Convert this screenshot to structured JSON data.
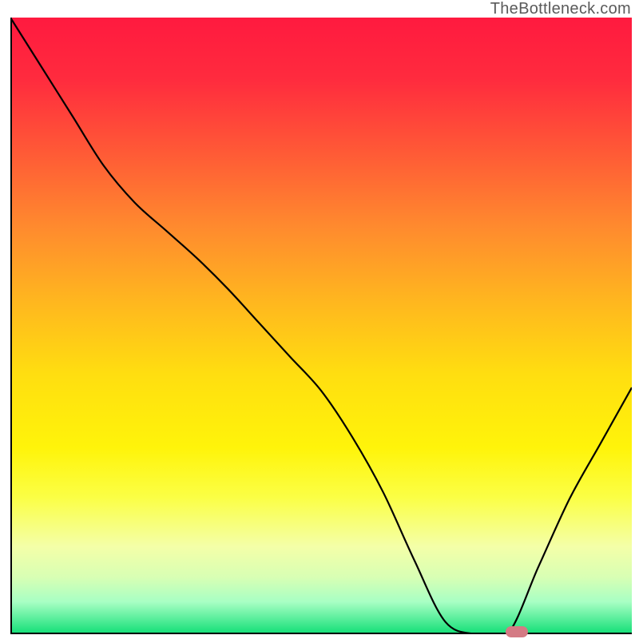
{
  "attribution": "TheBottleneck.com",
  "chart_data": {
    "type": "line",
    "title": "",
    "xlabel": "",
    "ylabel": "",
    "x": [
      0,
      1,
      2,
      3,
      4,
      5,
      6,
      7,
      8,
      9,
      10,
      11,
      12,
      13,
      14,
      15,
      16,
      17,
      18,
      19,
      20
    ],
    "values": [
      100,
      92,
      84,
      76,
      70,
      65.5,
      61,
      56,
      50.5,
      45,
      39.5,
      32,
      23,
      12,
      2,
      0,
      0,
      11,
      22,
      31,
      40
    ],
    "xlim": [
      0,
      20
    ],
    "ylim": [
      0,
      100
    ],
    "marker": {
      "x": 16.3,
      "y": 0
    },
    "colors": {
      "top": "#ff1a3f",
      "mid": "#ffde10",
      "bottom": "#18e07a",
      "marker": "#d47a84"
    }
  }
}
